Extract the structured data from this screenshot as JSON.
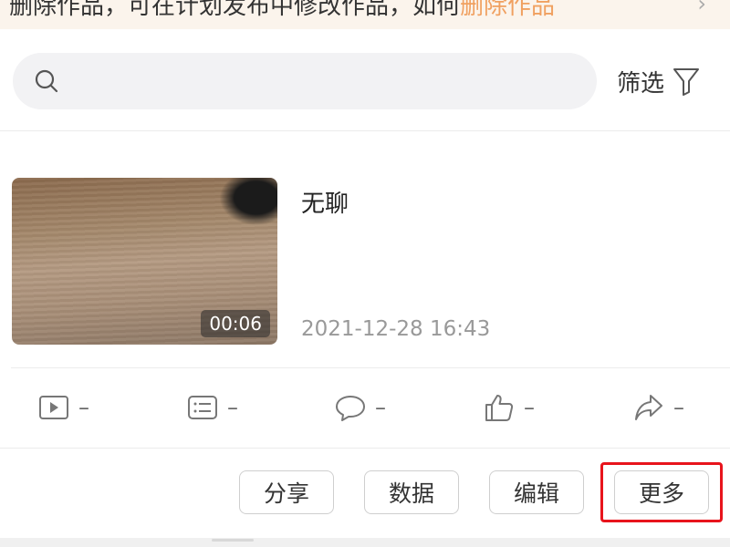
{
  "banner": {
    "text_main": "删除作品，可在计划发布中修改作品，如何",
    "text_highlight": "删除作品",
    "arrow": "›"
  },
  "search": {
    "placeholder": "",
    "value": "",
    "icon": "search-icon"
  },
  "filter": {
    "label": "筛选",
    "icon": "filter-icon"
  },
  "video": {
    "title": "无聊",
    "duration": "00:06",
    "date": "2021-12-28 16:43"
  },
  "stats": [
    {
      "icon": "play-icon",
      "value": "–"
    },
    {
      "icon": "list-icon",
      "value": "–"
    },
    {
      "icon": "comment-icon",
      "value": "–"
    },
    {
      "icon": "like-icon",
      "value": "–"
    },
    {
      "icon": "share-icon",
      "value": "–"
    }
  ],
  "actions": {
    "share": "分享",
    "data": "数据",
    "edit": "编辑",
    "more": "更多"
  },
  "colors": {
    "highlight_border": "#e8141c",
    "banner_bg": "#fbf4ec",
    "banner_accent": "#f0a060"
  }
}
